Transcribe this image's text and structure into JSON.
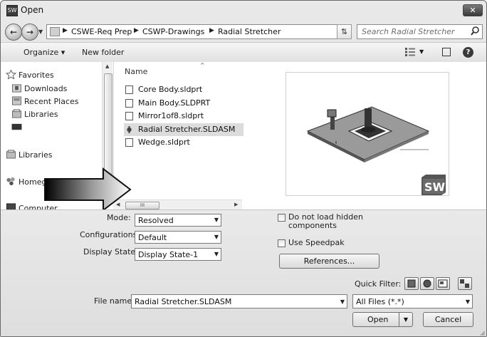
{
  "window": {
    "title": "Open",
    "close_label": "✕"
  },
  "nav": {
    "breadcrumbs": [
      "CSWE-Req Prep",
      "CSWP-Drawings",
      "Radial Stretcher"
    ],
    "search_placeholder": "Search Radial Stretcher"
  },
  "toolbar": {
    "organize_label": "Organize ▾",
    "new_folder_label": "New folder"
  },
  "sidebar": {
    "items": [
      {
        "label": "Favorites",
        "icon": "star-icon"
      },
      {
        "label": "Downloads",
        "icon": "downloads-folder-icon"
      },
      {
        "label": "Recent Places",
        "icon": "recent-places-icon"
      },
      {
        "label": "Libraries",
        "icon": "libraries-icon"
      },
      {
        "label": "",
        "icon": "desktop-icon"
      },
      {
        "label": "Libraries",
        "icon": "libraries-icon"
      },
      {
        "label": "Homegroup",
        "icon": "homegroup-icon"
      },
      {
        "label": "Computer",
        "icon": "computer-icon"
      }
    ]
  },
  "files": {
    "column_header": "Name",
    "items": [
      {
        "name": "Core Body.sldprt",
        "type": "part",
        "selected": false
      },
      {
        "name": "Main Body.SLDPRT",
        "type": "part",
        "selected": false
      },
      {
        "name": "Mirror1of8.sldprt",
        "type": "part",
        "selected": false
      },
      {
        "name": "Radial Stretcher.SLDASM",
        "type": "assembly",
        "selected": true
      },
      {
        "name": "Wedge.sldprt",
        "type": "part",
        "selected": false
      }
    ],
    "hscroll_thumb": "III"
  },
  "options": {
    "mode_label": "Mode:",
    "mode_value": "Resolved",
    "configurations_label": "Configurations:",
    "configurations_value": "Default",
    "display_states_label": "Display States:",
    "display_states_value": "Display State-1",
    "do_not_load_label": "Do not load hidden components",
    "use_speedpak_label": "Use Speedpak",
    "references_label": "References...",
    "quick_filter_label": "Quick Filter:"
  },
  "footer": {
    "file_name_label": "File name:",
    "file_name_value": "Radial Stretcher.SLDASM",
    "file_type_value": "All Files (*.*)",
    "open_label": "Open",
    "cancel_label": "Cancel"
  },
  "colors": {
    "selection": "#dcdcdc",
    "chrome": "#e2e2e2",
    "arrow_fill_dark": "#000000"
  }
}
